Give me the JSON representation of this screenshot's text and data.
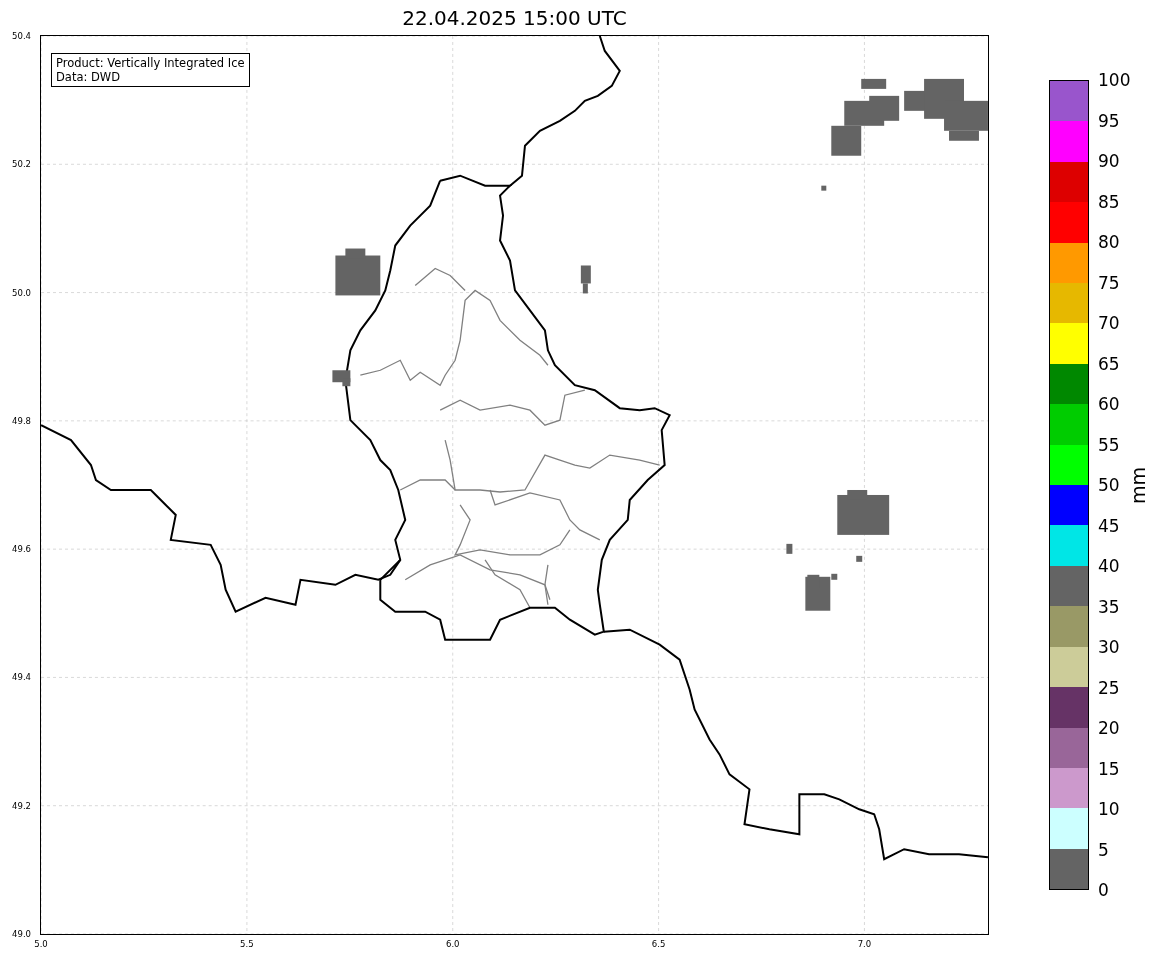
{
  "title": "22.04.2025 15:00 UTC",
  "info_box": {
    "lines": [
      "Product: Vertically Integrated Ice",
      "Data: DWD"
    ]
  },
  "x_ticks": [
    "5.0",
    "5.5",
    "6.0",
    "6.5",
    "7.0"
  ],
  "y_ticks": [
    "50.4",
    "50.2",
    "50.0",
    "49.8",
    "49.6",
    "49.4",
    "49.2",
    "49.0"
  ],
  "colorbar": {
    "label": "mm",
    "ticks": [
      "100",
      "95",
      "90",
      "85",
      "80",
      "75",
      "70",
      "65",
      "60",
      "55",
      "50",
      "45",
      "40",
      "35",
      "30",
      "25",
      "20",
      "15",
      "10",
      "5",
      "0"
    ],
    "segments": [
      {
        "color": "#9955cc"
      },
      {
        "color": "#ff00ff"
      },
      {
        "color": "#dd0000"
      },
      {
        "color": "#ff0000"
      },
      {
        "color": "#ff9900"
      },
      {
        "color": "#e6b800"
      },
      {
        "color": "#ffff00"
      },
      {
        "color": "#008800"
      },
      {
        "color": "#00cc00"
      },
      {
        "color": "#00ff00"
      },
      {
        "color": "#0000ff"
      },
      {
        "color": "#00e6e6"
      },
      {
        "color": "#646464"
      },
      {
        "color": "#999966"
      },
      {
        "color": "#cccc99"
      },
      {
        "color": "#663366"
      },
      {
        "color": "#996699"
      },
      {
        "color": "#cc99cc"
      },
      {
        "color": "#ccffff"
      },
      {
        "color": "#646464"
      }
    ]
  }
}
